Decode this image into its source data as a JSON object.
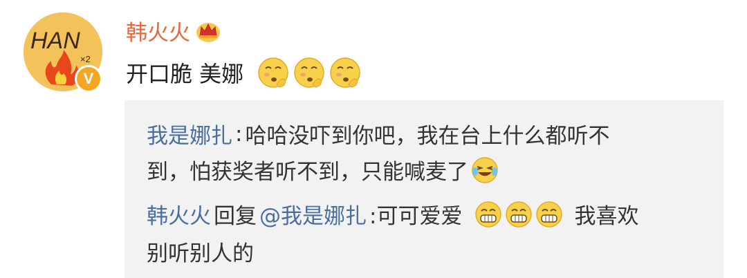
{
  "comment": {
    "username": "韩火火",
    "avatar_text": "HAN",
    "avatar_sub": "×2",
    "verified_badge": "V",
    "post_text": "开口脆 美娜",
    "post_emojis": [
      "shy-face-emoji",
      "shy-face-emoji",
      "shy-face-emoji"
    ],
    "crown_icon": "crown-icon"
  },
  "replies": [
    {
      "author": "我是娜扎",
      "sep": ": ",
      "line1": "哈哈没吓到你吧，我在台上什么都听不",
      "line2": "到，怕获奖者听不到，只能喊麦了",
      "emoji": "laugh-cry-emoji"
    },
    {
      "author": "韩火火",
      "action": "回复",
      "mention": "@我是娜扎",
      "text1": ":可可爱爱",
      "text2": "我喜欢",
      "line2": "别听别人的",
      "emojis": [
        "grin-emoji",
        "grin-emoji",
        "grin-emoji"
      ]
    }
  ],
  "colors": {
    "username": "#e8663a",
    "link": "#4a6e9e",
    "reply_bg": "#f2f2f2",
    "badge": "#f5a623"
  }
}
